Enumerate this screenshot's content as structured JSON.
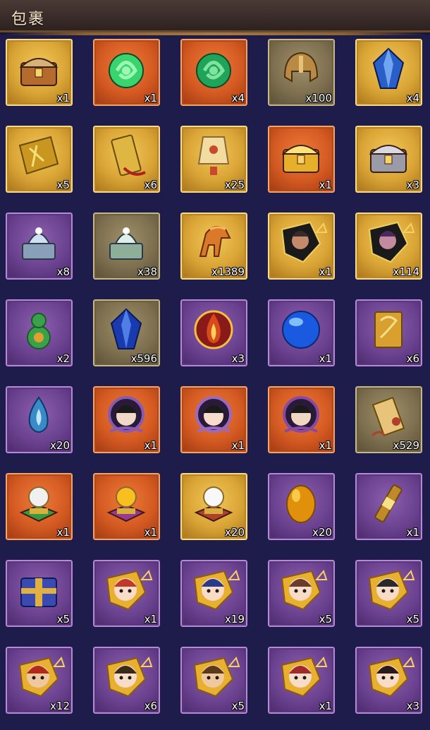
{
  "header": {
    "title": "包裹"
  },
  "items": [
    {
      "name": "treasure-chest",
      "quality": "gold",
      "count": "x1",
      "icon": "chest",
      "c1": "#b56a2e",
      "c2": "#d9b07a"
    },
    {
      "name": "green-jade-pendant",
      "quality": "orange",
      "count": "x1",
      "icon": "jade",
      "c1": "#39d46e",
      "c2": "#9cf7b3"
    },
    {
      "name": "jade-ring",
      "quality": "orange",
      "count": "x4",
      "icon": "jade",
      "c1": "#1fa459",
      "c2": "#7fe4a0"
    },
    {
      "name": "bronze-helmet",
      "quality": "khaki",
      "count": "x100",
      "icon": "helmet",
      "c1": "#b98a44",
      "c2": "#e4c27a"
    },
    {
      "name": "blue-crystal",
      "quality": "gold",
      "count": "x4",
      "icon": "crystal",
      "c1": "#2a5fc8",
      "c2": "#8ec4ff"
    },
    {
      "name": "gold-scroll-fragment",
      "quality": "gold",
      "count": "x5",
      "icon": "fragment",
      "c1": "#c99620",
      "c2": "#f5e07a"
    },
    {
      "name": "gold-token",
      "quality": "gold",
      "count": "x6",
      "icon": "token",
      "c1": "#e0b642",
      "c2": "#ffffff"
    },
    {
      "name": "sky-lantern",
      "quality": "gold",
      "count": "x25",
      "icon": "lantern",
      "c1": "#f3dca0",
      "c2": "#c74a2a"
    },
    {
      "name": "golden-dragon-chest",
      "quality": "orange",
      "count": "x1",
      "icon": "chest",
      "c1": "#e8b02a",
      "c2": "#ffe27a"
    },
    {
      "name": "silver-beast-chest",
      "quality": "gold",
      "count": "x3",
      "icon": "chest",
      "c1": "#9a9aa8",
      "c2": "#d8d8e4"
    },
    {
      "name": "silver-qilin-seal",
      "quality": "purple",
      "count": "x8",
      "icon": "seal",
      "c1": "#8aa0b8",
      "c2": "#cfe0f0"
    },
    {
      "name": "jade-pearl-seal",
      "quality": "khaki",
      "count": "x38",
      "icon": "seal",
      "c1": "#8fae9a",
      "c2": "#dfeee6"
    },
    {
      "name": "gold-horse-emblem",
      "quality": "gold",
      "count": "x1389",
      "icon": "horse",
      "c1": "#d97a2a",
      "c2": "#ffb35a"
    },
    {
      "name": "hero-shard-warrior",
      "quality": "gold",
      "count": "x1",
      "icon": "portrait",
      "c1": "#3a2a2a",
      "c2": "#c48a6a"
    },
    {
      "name": "hero-shard-sorceress",
      "quality": "gold",
      "count": "x114",
      "icon": "portrait",
      "c1": "#4a2a5a",
      "c2": "#c48aa0"
    },
    {
      "name": "green-gourd",
      "quality": "purple",
      "count": "x2",
      "icon": "gourd",
      "c1": "#3aa04a",
      "c2": "#e0a030"
    },
    {
      "name": "sapphire-crystal",
      "quality": "khaki",
      "count": "x596",
      "icon": "crystal",
      "c1": "#1a3ab0",
      "c2": "#6a9aff"
    },
    {
      "name": "flame-emblem",
      "quality": "purple",
      "count": "x3",
      "icon": "flame",
      "c1": "#d94a1a",
      "c2": "#ffd060"
    },
    {
      "name": "blue-orb",
      "quality": "purple",
      "count": "x1",
      "icon": "orb",
      "c1": "#1a5ae0",
      "c2": "#9ad8ff"
    },
    {
      "name": "gold-book",
      "quality": "purple",
      "count": "x6",
      "icon": "book",
      "c1": "#d9a030",
      "c2": "#f7e08a"
    },
    {
      "name": "blue-spirit-flame",
      "quality": "purple",
      "count": "x20",
      "icon": "wisp",
      "c1": "#3a8ac8",
      "c2": "#bfe8ff"
    },
    {
      "name": "portrait-lady-1",
      "quality": "orange",
      "count": "x1",
      "icon": "lady",
      "c1": "#8a5ab0",
      "c2": "#f0d8c8"
    },
    {
      "name": "portrait-lady-2",
      "quality": "orange",
      "count": "x1",
      "icon": "lady",
      "c1": "#9a6ac0",
      "c2": "#f5dccc"
    },
    {
      "name": "portrait-lady-3",
      "quality": "orange",
      "count": "x1",
      "icon": "lady",
      "c1": "#8a4aa0",
      "c2": "#f2d6c4"
    },
    {
      "name": "decree-scroll",
      "quality": "khaki",
      "count": "x529",
      "icon": "scroll",
      "c1": "#e8c47a",
      "c2": "#b0402a"
    },
    {
      "name": "orb-pedestal-portrait",
      "quality": "orange",
      "count": "x1",
      "icon": "pedestal",
      "c1": "#3a9a3a",
      "c2": "#f0f0f0"
    },
    {
      "name": "orb-pedestal-gold",
      "quality": "orange",
      "count": "x1",
      "icon": "pedestal",
      "c1": "#9a3a8a",
      "c2": "#f7c020"
    },
    {
      "name": "orb-pedestal-pearl",
      "quality": "gold",
      "count": "x20",
      "icon": "pedestal",
      "c1": "#b0402a",
      "c2": "#f8f8f8"
    },
    {
      "name": "golden-egg",
      "quality": "purple",
      "count": "x20",
      "icon": "egg",
      "c1": "#e0900a",
      "c2": "#ffd85a"
    },
    {
      "name": "command-scroll",
      "quality": "purple",
      "count": "x1",
      "icon": "rod",
      "c1": "#c08a2a",
      "c2": "#f7e08a"
    },
    {
      "name": "blue-gift-box",
      "quality": "purple",
      "count": "x5",
      "icon": "box",
      "c1": "#3a4ab0",
      "c2": "#e0b040"
    },
    {
      "name": "chibi-hero-fragment-1",
      "quality": "purple",
      "count": "x1",
      "icon": "chibi",
      "c1": "#c03a2a",
      "c2": "#f8dcc8"
    },
    {
      "name": "chibi-hero-fragment-2",
      "quality": "purple",
      "count": "x19",
      "icon": "chibi",
      "c1": "#2a3a8a",
      "c2": "#f8dcc8"
    },
    {
      "name": "chibi-hero-fragment-3",
      "quality": "purple",
      "count": "x5",
      "icon": "chibi",
      "c1": "#6a3a2a",
      "c2": "#f8dcc8"
    },
    {
      "name": "chibi-hero-fragment-4",
      "quality": "purple",
      "count": "x5",
      "icon": "chibi",
      "c1": "#2a2a2a",
      "c2": "#f8dcc8"
    },
    {
      "name": "chibi-hero-fragment-5",
      "quality": "purple",
      "count": "x12",
      "icon": "chibi",
      "c1": "#b02a1a",
      "c2": "#f0c8a0"
    },
    {
      "name": "chibi-hero-fragment-6",
      "quality": "purple",
      "count": "x6",
      "icon": "chibi",
      "c1": "#3a2a1a",
      "c2": "#f8dcc8"
    },
    {
      "name": "chibi-hero-fragment-7",
      "quality": "purple",
      "count": "x5",
      "icon": "chibi",
      "c1": "#5a3a1a",
      "c2": "#f0c8a0"
    },
    {
      "name": "chibi-hero-fragment-8",
      "quality": "purple",
      "count": "x1",
      "icon": "chibi",
      "c1": "#a02a2a",
      "c2": "#f8dcc8"
    },
    {
      "name": "chibi-hero-fragment-9",
      "quality": "purple",
      "count": "x3",
      "icon": "chibi",
      "c1": "#2a1a1a",
      "c2": "#f8dcc8"
    }
  ]
}
